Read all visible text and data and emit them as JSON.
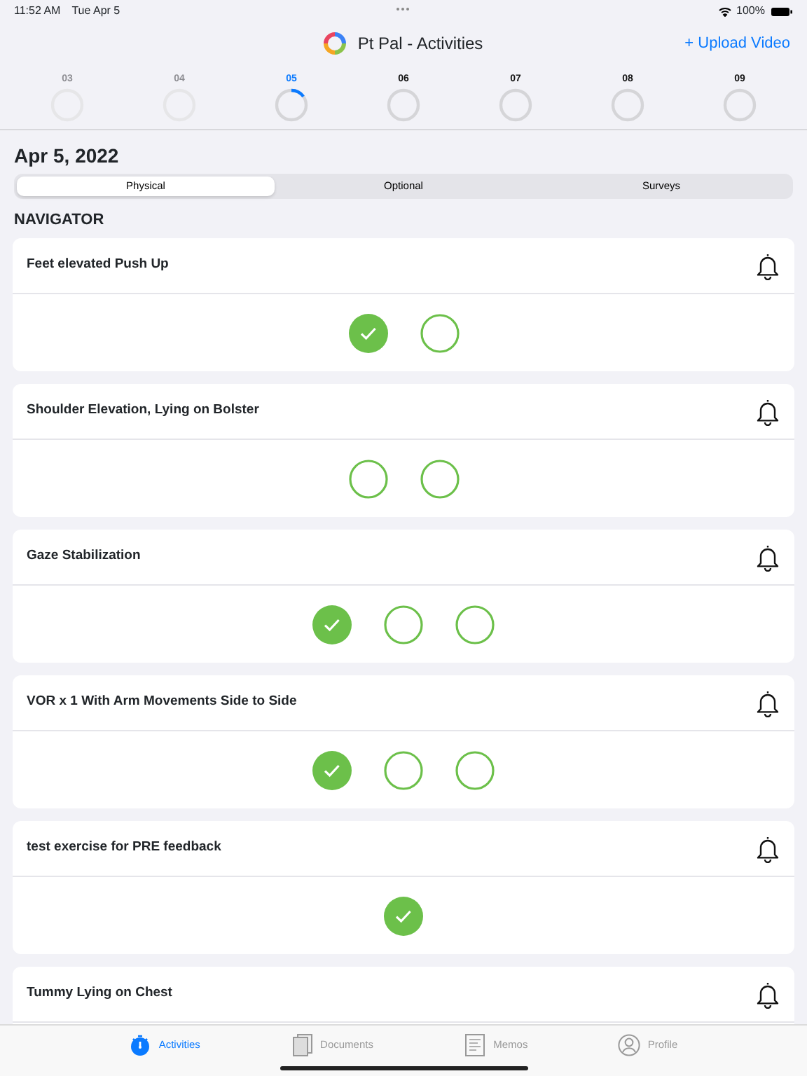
{
  "status_bar": {
    "time": "11:52 AM",
    "date": "Tue Apr 5",
    "battery": "100%"
  },
  "header": {
    "title": "Pt Pal - Activities",
    "action": "+ Upload Video"
  },
  "days": [
    {
      "label": "03",
      "past": true,
      "selected": false
    },
    {
      "label": "04",
      "past": true,
      "selected": false
    },
    {
      "label": "05",
      "past": false,
      "selected": true
    },
    {
      "label": "06",
      "past": false,
      "selected": false
    },
    {
      "label": "07",
      "past": false,
      "selected": false
    },
    {
      "label": "08",
      "past": false,
      "selected": false
    },
    {
      "label": "09",
      "past": false,
      "selected": false
    }
  ],
  "date_heading": "Apr 5, 2022",
  "segments": [
    {
      "label": "Physical",
      "selected": true
    },
    {
      "label": "Optional",
      "selected": false
    },
    {
      "label": "Surveys",
      "selected": false
    }
  ],
  "section_title": "NAVIGATOR",
  "exercises": [
    {
      "name": "Feet elevated Push Up",
      "sets": [
        {
          "done": true
        },
        {
          "done": false
        }
      ]
    },
    {
      "name": "Shoulder Elevation, Lying on Bolster",
      "sets": [
        {
          "done": false
        },
        {
          "done": false
        }
      ]
    },
    {
      "name": "Gaze Stabilization",
      "sets": [
        {
          "done": true
        },
        {
          "done": false
        },
        {
          "done": false
        }
      ]
    },
    {
      "name": "VOR x 1 With Arm Movements Side to Side",
      "sets": [
        {
          "done": true
        },
        {
          "done": false
        },
        {
          "done": false
        }
      ]
    },
    {
      "name": "test exercise for PRE feedback",
      "sets": [
        {
          "done": true
        }
      ]
    },
    {
      "name": "Tummy Lying on Chest"
    }
  ],
  "tab_bar": [
    {
      "label": "Activities",
      "selected": true,
      "kind": "timer"
    },
    {
      "label": "Documents",
      "selected": false,
      "kind": "documents"
    },
    {
      "label": "Memos",
      "selected": false,
      "kind": "memo"
    },
    {
      "label": "Profile",
      "selected": false,
      "kind": "profile"
    }
  ]
}
